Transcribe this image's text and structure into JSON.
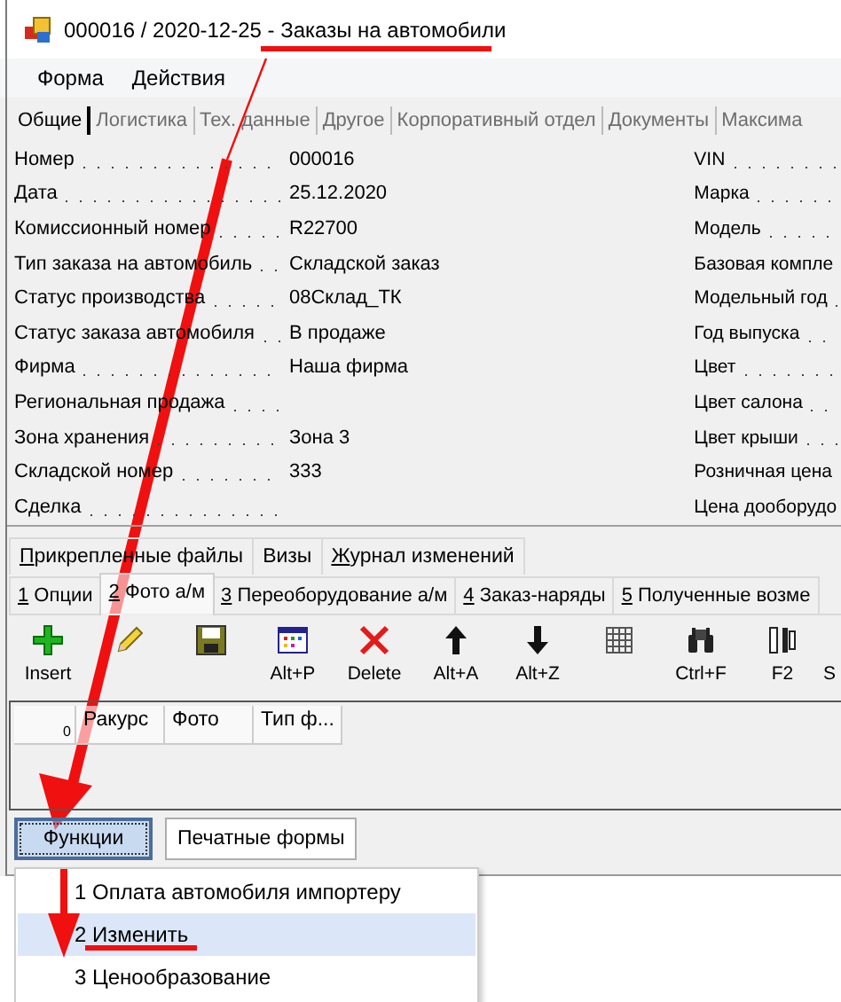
{
  "window": {
    "title": "000016 / 2020-12-25 - Заказы на автомобили"
  },
  "menu": [
    "Форма",
    "Действия"
  ],
  "tabs": [
    {
      "label": "Общие",
      "selected": true
    },
    {
      "label": "Логистика",
      "selected": false
    },
    {
      "label": "Тех. данные",
      "selected": false
    },
    {
      "label": "Другое",
      "selected": false
    },
    {
      "label": "Корпоративный отдел",
      "selected": false
    },
    {
      "label": "Документы",
      "selected": false
    },
    {
      "label": "Максима",
      "selected": false
    }
  ],
  "fields_left": [
    {
      "label": "Номер",
      "value": "000016"
    },
    {
      "label": "Дата",
      "value": "25.12.2020"
    },
    {
      "label": "Комиссионный номер",
      "value": "R22700"
    },
    {
      "label": "Тип заказа на автомобиль",
      "value": "Складской заказ"
    },
    {
      "label": "Статус производства",
      "value": "08Склад_ТК"
    },
    {
      "label": "Статус заказа автомобиля",
      "value": "В продаже"
    },
    {
      "label": "Фирма",
      "value": "Наша фирма"
    },
    {
      "label": "Региональная продажа"
    },
    {
      "label": "Зона хранения",
      "value": "Зона 3"
    },
    {
      "label": "Складской номер",
      "value": "333"
    },
    {
      "label": "Сделка"
    }
  ],
  "fields_right": [
    "VIN",
    "Марка",
    "Модель",
    "Базовая компле",
    "Модельный год",
    "Год выпуска",
    "Цвет",
    "Цвет салона",
    "Цвет крыши",
    "Розничная цена",
    "Цена дооборудо"
  ],
  "lower_tabs": [
    {
      "label": "Прикрепленные файлы",
      "mnemonic": true
    },
    {
      "label": "Визы",
      "mnemonic": false
    },
    {
      "label": "Журнал изменений",
      "mnemonic": true
    }
  ],
  "detail_tabs": [
    {
      "label": "1 Опции",
      "selected": false
    },
    {
      "label": "2 Фото а/м",
      "selected": true
    },
    {
      "label": "3 Переоборудование а/м",
      "selected": false
    },
    {
      "label": "4 Заказ-наряды",
      "selected": false
    },
    {
      "label": "5 Полученные возме",
      "selected": false
    }
  ],
  "toolbar": [
    {
      "kind": "insert",
      "label": "Insert"
    },
    {
      "kind": "edit"
    },
    {
      "kind": "save"
    },
    {
      "kind": "window",
      "label": "Alt+P"
    },
    {
      "kind": "delete",
      "label": "Delete"
    },
    {
      "kind": "up",
      "label": "Alt+A"
    },
    {
      "kind": "down",
      "label": "Alt+Z"
    },
    {
      "kind": "grid"
    },
    {
      "kind": "find",
      "label": "Ctrl+F"
    },
    {
      "kind": "columns",
      "label": "F2"
    },
    {
      "kind": "blank",
      "label": "S"
    }
  ],
  "grid": {
    "row_count": "0",
    "columns": [
      "Ракурс",
      "Фото",
      "Тип ф..."
    ]
  },
  "buttons": [
    {
      "label": "Функции",
      "selected": true
    },
    {
      "label": "Печатные формы",
      "selected": false
    }
  ],
  "dropdown": [
    {
      "label": "1 Оплата автомобиля импортеру",
      "selected": false
    },
    {
      "label": "2 Изменить",
      "selected": true
    },
    {
      "label": "3 Ценообразование",
      "selected": false
    }
  ]
}
